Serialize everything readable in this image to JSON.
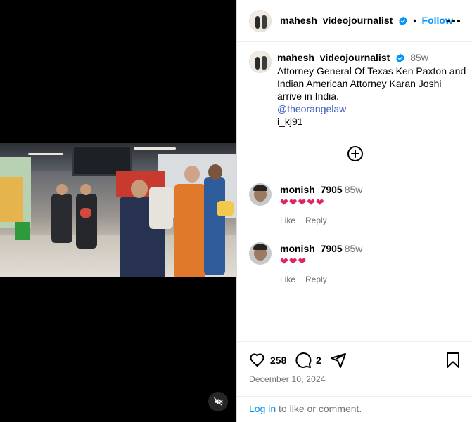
{
  "post": {
    "username": "mahesh_videojournalist",
    "follow_label": "Follow",
    "separator": "•",
    "more_label": "More options"
  },
  "caption": {
    "username": "mahesh_videojournalist",
    "time": "85w",
    "text": "Attorney General Of Texas Ken Paxton and Indian American Attorney Karan Joshi arrive in India.",
    "mention": "@theorangelaw",
    "tag": "i_kj91"
  },
  "comments": [
    {
      "username": "monish_7905",
      "time": "85w",
      "content": "❤❤❤❤❤",
      "like_label": "Like",
      "reply_label": "Reply"
    },
    {
      "username": "monish_7905",
      "time": "85w",
      "content": "❤❤❤",
      "like_label": "Like",
      "reply_label": "Reply"
    }
  ],
  "engagement": {
    "likes": "258",
    "comments": "2",
    "date": "December 10, 2024"
  },
  "footer": {
    "login_label": "Log in",
    "login_suffix": " to like or comment."
  },
  "colors": {
    "accent": "#0095f6",
    "verified": "#0095f6",
    "heart": "#e0245e",
    "secondary_text": "#737373"
  },
  "icons": {
    "mute": "speaker-muted-icon",
    "more": "ellipsis-icon",
    "add": "plus-circle-icon",
    "like": "heart-icon",
    "comment": "comment-bubble-icon",
    "share": "paper-plane-icon",
    "save": "bookmark-icon"
  }
}
